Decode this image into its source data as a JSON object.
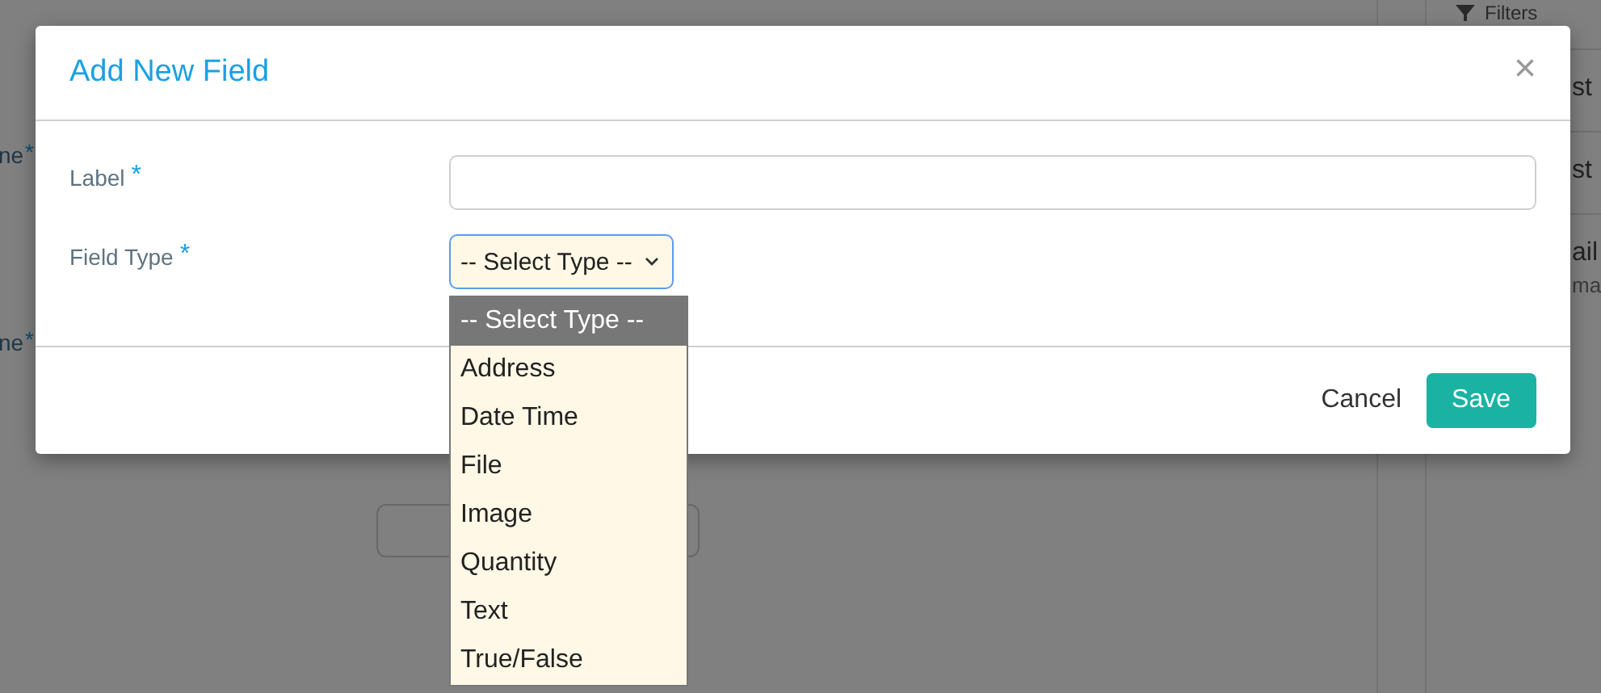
{
  "background": {
    "left_labels": [
      {
        "text": "ne",
        "required": "*"
      },
      {
        "text": "ne",
        "required": "*"
      }
    ],
    "filters": {
      "label": "Filters"
    },
    "side_items": [
      {
        "text": "st"
      },
      {
        "text": "st"
      },
      {
        "text": "ail",
        "subtext": "ma"
      }
    ]
  },
  "dialog": {
    "title": "Add New Field",
    "close": "×",
    "fields": [
      {
        "kind": "text",
        "label": "Label",
        "required": "*"
      },
      {
        "kind": "select",
        "label": "Field Type",
        "required": "*",
        "value": "-- Select Type --",
        "expanded": true,
        "options": [
          {
            "label": "-- Select Type --",
            "selected": true
          },
          {
            "label": "Address",
            "selected": false
          },
          {
            "label": "Date Time",
            "selected": false
          },
          {
            "label": "File",
            "selected": false
          },
          {
            "label": "Image",
            "selected": false
          },
          {
            "label": "Quantity",
            "selected": false
          },
          {
            "label": "Text",
            "selected": false
          },
          {
            "label": "True/False",
            "selected": false
          }
        ]
      }
    ],
    "buttons": [
      {
        "kind": "link",
        "label": "Cancel"
      },
      {
        "kind": "primary",
        "label": "Save"
      }
    ]
  }
}
